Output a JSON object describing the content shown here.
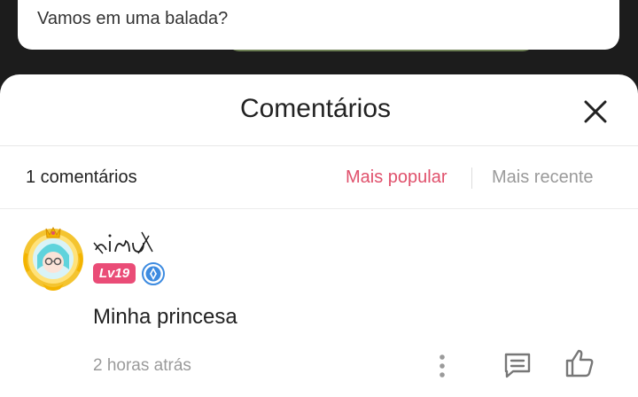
{
  "post": {
    "text": "Vamos em uma balada?"
  },
  "sheet": {
    "title": "Comentários",
    "close_icon": "close-icon"
  },
  "sort": {
    "count_label": "1 comentários",
    "popular_label": "Mais popular",
    "recent_label": "Mais recente",
    "active": "popular",
    "active_color": "#e0516c",
    "inactive_color": "#9a9a9a"
  },
  "comments": [
    {
      "username": "ɒɪmʊ",
      "level": "Lv19",
      "level_color": "#ea4c77",
      "verified_icon": "verified-badge-icon",
      "text": "Minha princesa",
      "timestamp": "2 horas atrás",
      "actions": [
        "more-options-icon",
        "reply-icon",
        "like-icon"
      ]
    }
  ]
}
